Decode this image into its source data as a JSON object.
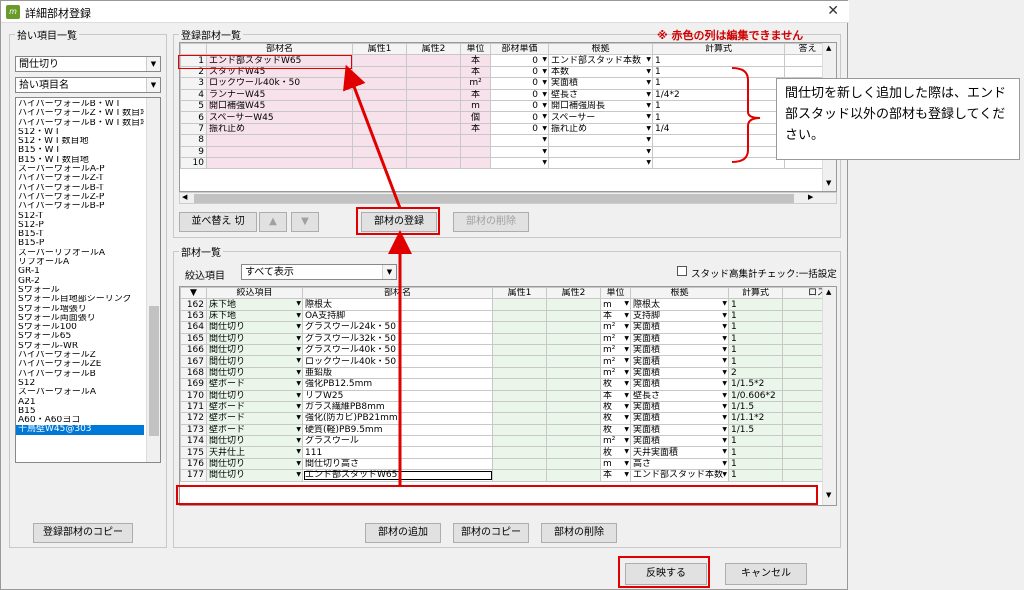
{
  "window": {
    "title": "詳細部材登録"
  },
  "left": {
    "group_label": "拾い項目一覧",
    "combo1": "間仕切り",
    "combo2": "拾い項目名",
    "items": [
      "ハイパーウォールB・W I",
      "ハイパーウォールZ・W I 数目地",
      "ハイパーウォールB・W I 数目地",
      "S12・W I",
      "S12・W I 数目地",
      "B15・W I",
      "B15・W I 数目地",
      "スーパーウォールA-P",
      "ハイパーウォールZ-T",
      "ハイパーウォールB-T",
      "ハイパーウォールZ-P",
      "ハイパーウォールB-P",
      "S12-T",
      "S12-P",
      "B15-T",
      "B15-P",
      "スーパーリブオールA",
      "リブオールA",
      "GR-1",
      "GR-2",
      "Sウォール",
      "Sウォール目地部シーリング",
      "Sウォール増張り",
      "Sウォール両面張り",
      "Sウォール100",
      "Sウォール65",
      "Sウォール-WR",
      "ハイパーウォールZ",
      "ハイパーウォールZE",
      "ハイパーウォールB",
      "S12",
      "スーパーウォールA",
      "A21",
      "B15",
      "A60・A60ヨコ",
      "千鳥壁W45@303"
    ],
    "copy_button": "登録部材のコピー"
  },
  "registered": {
    "group_label": "登録部材一覧",
    "warning": "※ 赤色の列は編集できません",
    "headers": [
      "部材名",
      "属性1",
      "属性2",
      "単位",
      "部材単価",
      "根拠",
      "計算式",
      "答え"
    ],
    "rows": [
      {
        "no": "1",
        "name": "エンド部スタッドW65",
        "unit": "本",
        "price": "0",
        "basis": "エンド部スタッド本数",
        "formula": "1"
      },
      {
        "no": "2",
        "name": "スタッドW45",
        "unit": "本",
        "price": "0",
        "basis": "本数",
        "formula": "1"
      },
      {
        "no": "3",
        "name": "ロックウール40k・50",
        "unit": "m²",
        "price": "0",
        "basis": "実面積",
        "formula": "1"
      },
      {
        "no": "4",
        "name": "ランナーW45",
        "unit": "本",
        "price": "0",
        "basis": "壁長さ",
        "formula": "1/4*2"
      },
      {
        "no": "5",
        "name": "開口補強W45",
        "unit": "m",
        "price": "0",
        "basis": "開口補強周長",
        "formula": "1"
      },
      {
        "no": "6",
        "name": "スペーサーW45",
        "unit": "個",
        "price": "0",
        "basis": "スペーサー",
        "formula": "1"
      },
      {
        "no": "7",
        "name": "振れ止め",
        "unit": "本",
        "price": "0",
        "basis": "振れ止め",
        "formula": "1/4"
      },
      {
        "no": "8",
        "name": "",
        "unit": "",
        "price": "",
        "basis": "",
        "formula": ""
      },
      {
        "no": "9",
        "name": "",
        "unit": "",
        "price": "",
        "basis": "",
        "formula": ""
      },
      {
        "no": "10",
        "name": "",
        "unit": "",
        "price": "",
        "basis": "",
        "formula": ""
      }
    ],
    "sort_button": "並べ替え 切",
    "up_button": "▲",
    "down_button": "▼",
    "register_button": "部材の登録",
    "delete_button": "部材の削除"
  },
  "parts": {
    "group_label": "部材一覧",
    "filter_label": "絞込項目",
    "filter_value": "すべて表示",
    "stud_check_label": "スタッド高集計チェック:一括設定",
    "headers": [
      "▼",
      "絞込項目",
      "部材名",
      "属性1",
      "属性2",
      "単位",
      "根拠",
      "計算式",
      "ロス率"
    ],
    "rows": [
      {
        "no": "162",
        "cat": "床下地",
        "name": "際根太",
        "unit": "m",
        "basis": "際根太",
        "formula": "1"
      },
      {
        "no": "163",
        "cat": "床下地",
        "name": "OA支持脚",
        "unit": "本",
        "basis": "支持脚",
        "formula": "1"
      },
      {
        "no": "164",
        "cat": "間仕切り",
        "name": "グラスウール24k・50",
        "unit": "m²",
        "basis": "実面積",
        "formula": "1"
      },
      {
        "no": "165",
        "cat": "間仕切り",
        "name": "グラスウール32k・50",
        "unit": "m²",
        "basis": "実面積",
        "formula": "1"
      },
      {
        "no": "166",
        "cat": "間仕切り",
        "name": "グラスウール40k・50",
        "unit": "m²",
        "basis": "実面積",
        "formula": "1"
      },
      {
        "no": "167",
        "cat": "間仕切り",
        "name": "ロックウール40k・50",
        "unit": "m²",
        "basis": "実面積",
        "formula": "1"
      },
      {
        "no": "168",
        "cat": "間仕切り",
        "name": "亜鉛版",
        "unit": "m²",
        "basis": "実面積",
        "formula": "2"
      },
      {
        "no": "169",
        "cat": "壁ボード",
        "name": "強化PB12.5mm",
        "unit": "枚",
        "basis": "実面積",
        "formula": "1/1.5*2"
      },
      {
        "no": "170",
        "cat": "間仕切り",
        "name": "リブW25",
        "unit": "本",
        "basis": "壁長さ",
        "formula": "1/0.606*2"
      },
      {
        "no": "171",
        "cat": "壁ボード",
        "name": "ガラス繊維PB8mm",
        "unit": "枚",
        "basis": "実面積",
        "formula": "1/1.5"
      },
      {
        "no": "172",
        "cat": "壁ボード",
        "name": "強化(防カビ)PB21mm",
        "unit": "枚",
        "basis": "実面積",
        "formula": "1/1.1*2"
      },
      {
        "no": "173",
        "cat": "壁ボード",
        "name": "硬質(軽)PB9.5mm",
        "unit": "枚",
        "basis": "実面積",
        "formula": "1/1.5"
      },
      {
        "no": "174",
        "cat": "間仕切り",
        "name": "グラスウール",
        "unit": "m²",
        "basis": "実面積",
        "formula": "1"
      },
      {
        "no": "175",
        "cat": "天井仕上",
        "name": "111",
        "unit": "枚",
        "basis": "天井実面積",
        "formula": "1"
      },
      {
        "no": "176",
        "cat": "間仕切り",
        "name": "間仕切り高さ",
        "unit": "m",
        "basis": "高さ",
        "formula": "1"
      },
      {
        "no": "177",
        "cat": "間仕切り",
        "name": "エンド部スタッドW65",
        "unit": "本",
        "basis": "エンド部スタッド本数",
        "formula": "1"
      }
    ],
    "add_button": "部材の追加",
    "copy_button": "部材のコピー",
    "delete_button": "部材の削除"
  },
  "footer": {
    "apply_button": "反映する",
    "cancel_button": "キャンセル"
  },
  "note": {
    "text": "間仕切を新しく追加した際は、エンド部スタッド以外の部材も登録してください。"
  },
  "colors": {
    "red": "#e00000",
    "pink": "#f7e1ea",
    "green": "#eaf6ea",
    "selected": "#0078d7"
  }
}
